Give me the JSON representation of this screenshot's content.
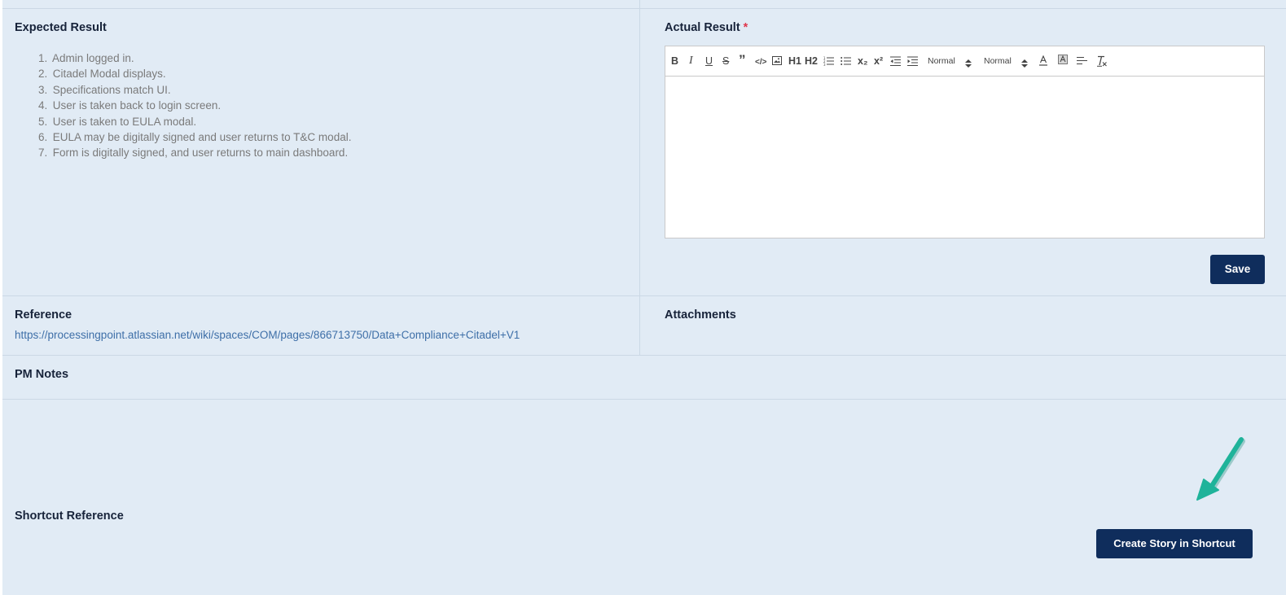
{
  "expected_result": {
    "label": "Expected Result",
    "steps": [
      {
        "num": "1.",
        "text": "Admin logged in."
      },
      {
        "num": "2.",
        "text": "Citadel Modal displays."
      },
      {
        "num": "3.",
        "text": "Specifications match UI."
      },
      {
        "num": "4.",
        "text": "User is taken back to login screen."
      },
      {
        "num": "5.",
        "text": "User is taken to EULA modal."
      },
      {
        "num": "6.",
        "text": "EULA may be digitally signed and user returns to T&C modal."
      },
      {
        "num": "7.",
        "text": "Form is digitally signed, and user returns to main dashboard."
      }
    ]
  },
  "actual_result": {
    "label": "Actual Result",
    "required_mark": "*",
    "editor": {
      "toolbar": {
        "bold": "B",
        "italic": "I",
        "underline": "U",
        "strike": "S",
        "blockquote": "”",
        "code": "</>",
        "h1": "H1",
        "h2": "H2",
        "subscript": "x₂",
        "superscript": "x²",
        "size_value": "Normal",
        "header_value": "Normal"
      },
      "content": ""
    },
    "save_label": "Save"
  },
  "reference": {
    "label": "Reference",
    "link": "https://processingpoint.atlassian.net/wiki/spaces/COM/pages/866713750/Data+Compliance+Citadel+V1"
  },
  "attachments": {
    "label": "Attachments"
  },
  "pm_notes": {
    "label": "PM Notes"
  },
  "shortcut": {
    "label": "Shortcut Reference",
    "create_label": "Create Story in Shortcut"
  },
  "colors": {
    "panel_bg": "#e1ebf5",
    "button_bg": "#0f2d5c",
    "link": "#3e6fa8",
    "required": "#e0364b",
    "arrow": "#1fb39a"
  },
  "icons": [
    "ordered-list-icon",
    "bullet-list-icon",
    "outdent-icon",
    "indent-icon",
    "image-icon",
    "font-color-icon",
    "background-color-icon",
    "align-icon",
    "clear-format-icon",
    "chevron-up-down-icon",
    "arrow-annotation-icon"
  ]
}
